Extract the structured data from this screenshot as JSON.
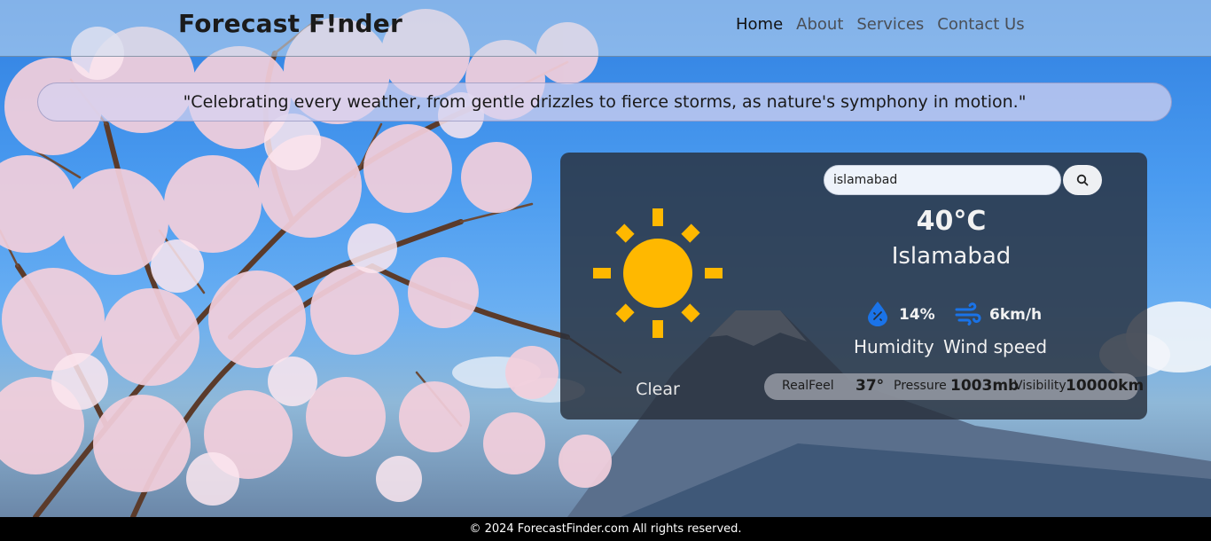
{
  "brand": "Forecast F!nder",
  "nav": {
    "home": "Home",
    "about": "About",
    "services": "Services",
    "contact": "Contact Us"
  },
  "quote": "\"Celebrating every weather, from gentle drizzles to fierce storms, as nature's symphony in motion.\"",
  "weather": {
    "search_value": "islamabad",
    "temperature": "40°C",
    "city": "Islamabad",
    "condition": "Clear",
    "humidity_value": "14%",
    "humidity_label": "Humidity",
    "wind_value": "6km/h",
    "wind_label": "Wind speed",
    "realfeel_label": "RealFeel",
    "realfeel_value": "37°",
    "pressure_label": "Pressure",
    "pressure_value": "1003mb",
    "visibility_label": "Visibility",
    "visibility_value": "10000km"
  },
  "icons": {
    "sun": "sun-icon",
    "search": "search-icon",
    "humidity": "water-drop-icon",
    "wind": "wind-icon"
  },
  "colors": {
    "sun": "#FFB800",
    "accent_icon": "#1a73e8",
    "card_bg": "#28303c"
  },
  "footer": "© 2024 ForecastFinder.com All rights reserved."
}
